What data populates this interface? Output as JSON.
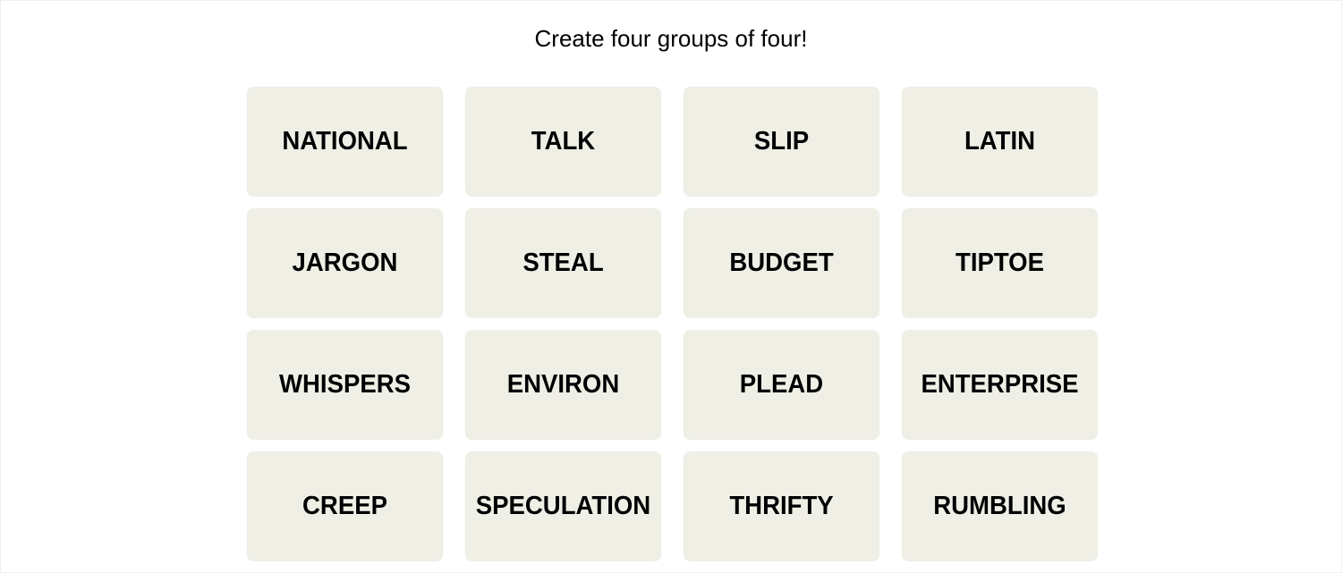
{
  "instructions": "Create four groups of four!",
  "tiles": [
    "NATIONAL",
    "TALK",
    "SLIP",
    "LATIN",
    "JARGON",
    "STEAL",
    "BUDGET",
    "TIPTOE",
    "WHISPERS",
    "ENVIRON",
    "PLEAD",
    "ENTERPRISE",
    "CREEP",
    "SPECULATION",
    "THRIFTY",
    "RUMBLING"
  ],
  "colors": {
    "tile_bg": "#efefe6",
    "text": "#000000"
  }
}
